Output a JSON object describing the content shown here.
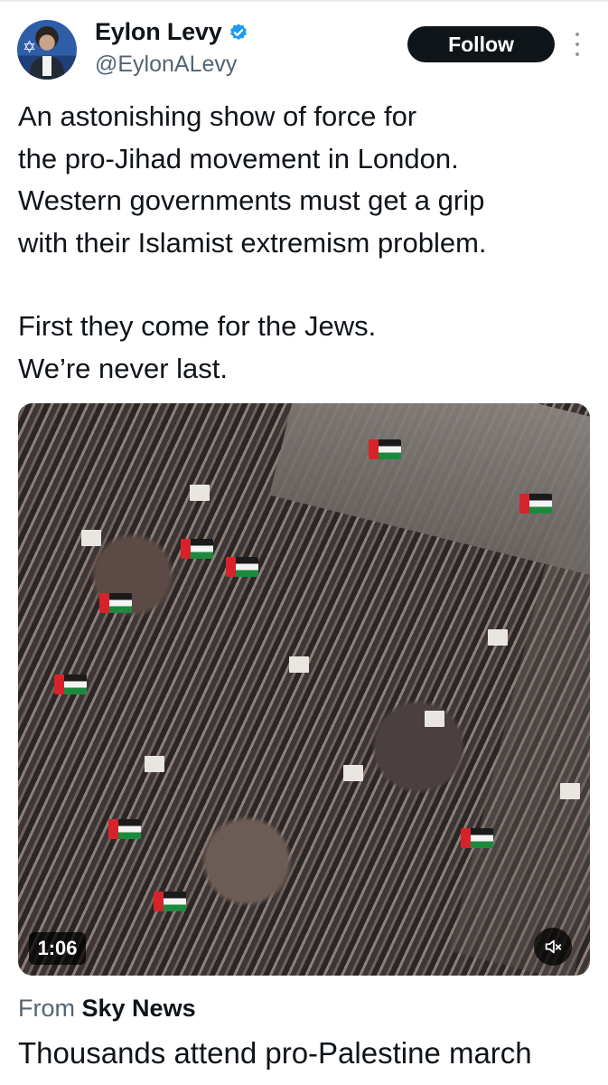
{
  "author": {
    "name": "Eylon Levy",
    "handle": "@EylonALevy",
    "verified": true,
    "follow_label": "Follow"
  },
  "tweet": {
    "lines": [
      "An astonishing show of force for",
      "the pro-Jihad movement in London.",
      "Western governments must get a grip",
      "with their Islamist extremism problem.",
      "First they come for the Jews.",
      "We’re never last."
    ]
  },
  "media": {
    "duration": "1:06",
    "muted": true
  },
  "card": {
    "source_prefix": "From",
    "source_name": "Sky News",
    "headline": "Thousands attend pro-Palestine march"
  },
  "colors": {
    "accent_blue": "#1d9bf0",
    "text_primary": "#0f1419",
    "text_secondary": "#536471",
    "follow_bg": "#0f1419"
  },
  "icons": {
    "verified": "verified-badge-icon",
    "more": "more-options-icon",
    "mute": "volume-muted-icon"
  }
}
